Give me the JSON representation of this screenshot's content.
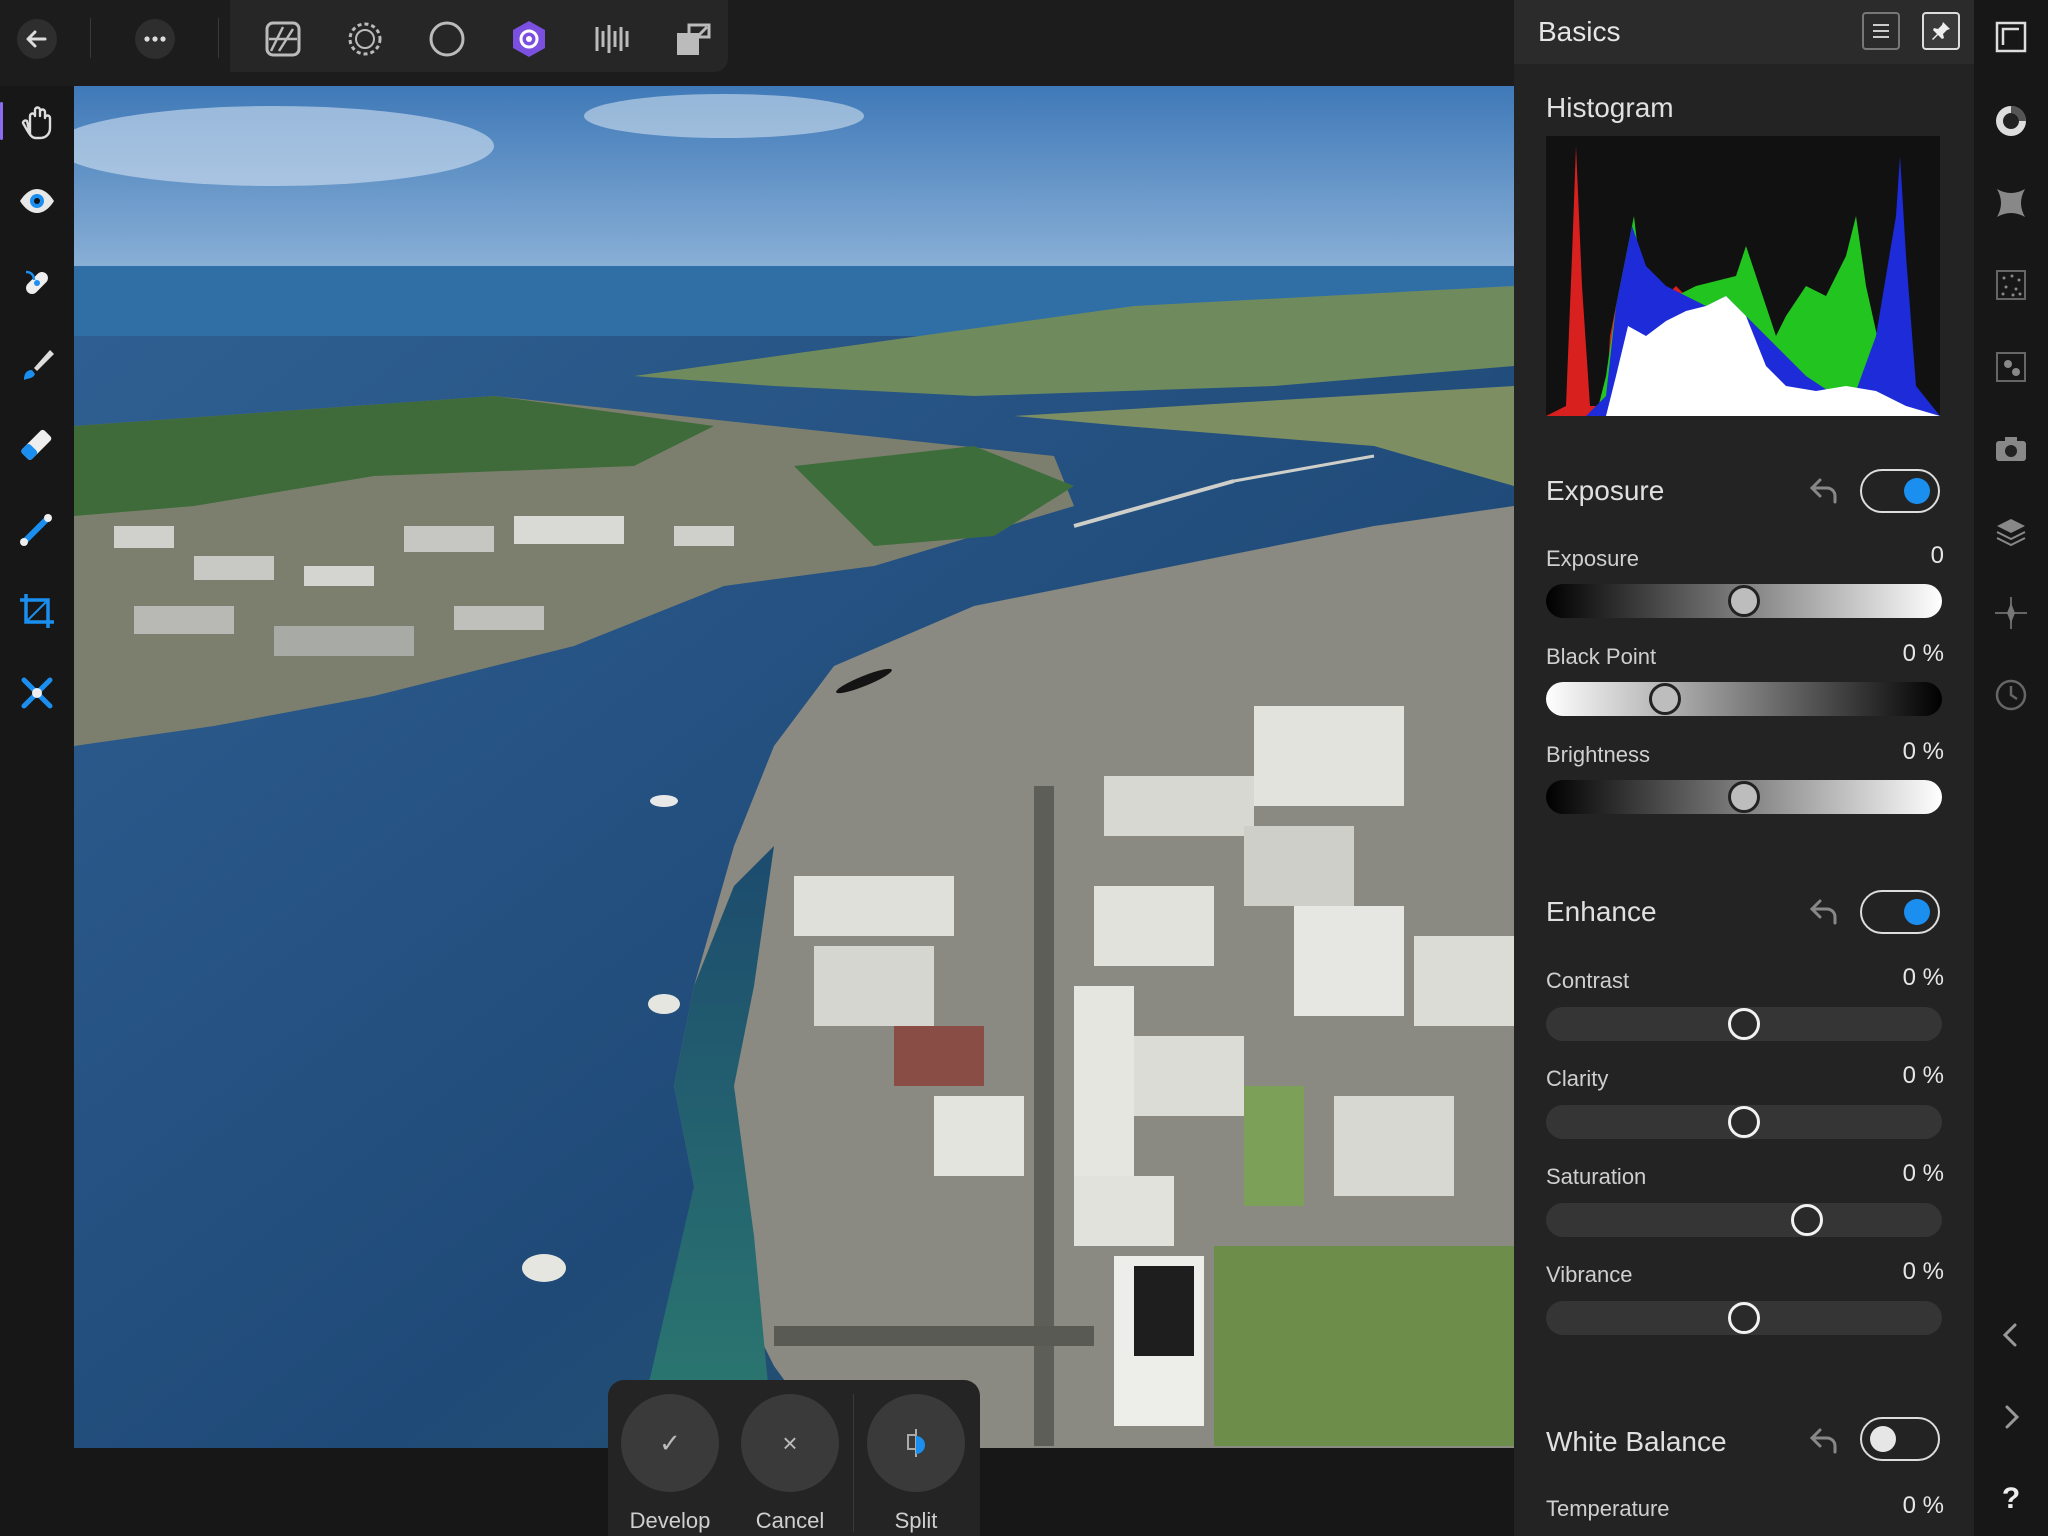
{
  "toolbar": {
    "icons": [
      "back-arrow-icon",
      "more-icon",
      "photo-persona-icon",
      "liquify-persona-icon",
      "tone-map-persona-icon",
      "develop-persona-icon",
      "export-persona-icon",
      "document-persona-icon"
    ]
  },
  "tools": [
    "view-tool-icon",
    "eye-tool-icon",
    "repair-tool-icon",
    "brush-tool-icon",
    "eraser-tool-icon",
    "gradient-tool-icon",
    "crop-tool-icon",
    "red-eye-tool-icon"
  ],
  "actions": {
    "develop": {
      "label": "Develop",
      "icon": "✓"
    },
    "cancel": {
      "label": "Cancel",
      "icon": "×"
    },
    "split": {
      "label": "Split"
    }
  },
  "panel": {
    "title": "Basics",
    "histogram_title": "Histogram",
    "sections": {
      "exposure": {
        "title": "Exposure",
        "enabled": true,
        "sliders": [
          {
            "label": "Exposure",
            "value": "0",
            "level": 0.5
          },
          {
            "label": "Black Point",
            "value": "0 %",
            "level": 0.3
          },
          {
            "label": "Brightness",
            "value": "0 %",
            "level": 0.5
          }
        ]
      },
      "enhance": {
        "title": "Enhance",
        "enabled": true,
        "sliders": [
          {
            "label": "Contrast",
            "value": "0 %",
            "level": 0.5
          },
          {
            "label": "Clarity",
            "value": "0 %",
            "level": 0.5
          },
          {
            "label": "Saturation",
            "value": "0 %",
            "level": 0.66
          },
          {
            "label": "Vibrance",
            "value": "0 %",
            "level": 0.5
          }
        ]
      },
      "white_balance": {
        "title": "White Balance",
        "enabled": false,
        "sliders": [
          {
            "label": "Temperature",
            "value": "0 %"
          }
        ]
      }
    }
  },
  "rail": [
    "full-screen-icon",
    "scope-icon",
    "vignette-icon",
    "noise-icon",
    "detail-icon",
    "lens-icon",
    "layers-icon",
    "overlays-icon",
    "history-icon",
    "collapse-left-icon",
    "expand-right-icon",
    "help-icon"
  ],
  "rail_help_label": "?",
  "colors": {
    "accent": "#1a8ff0",
    "persona_active": "#7b4fe0"
  }
}
